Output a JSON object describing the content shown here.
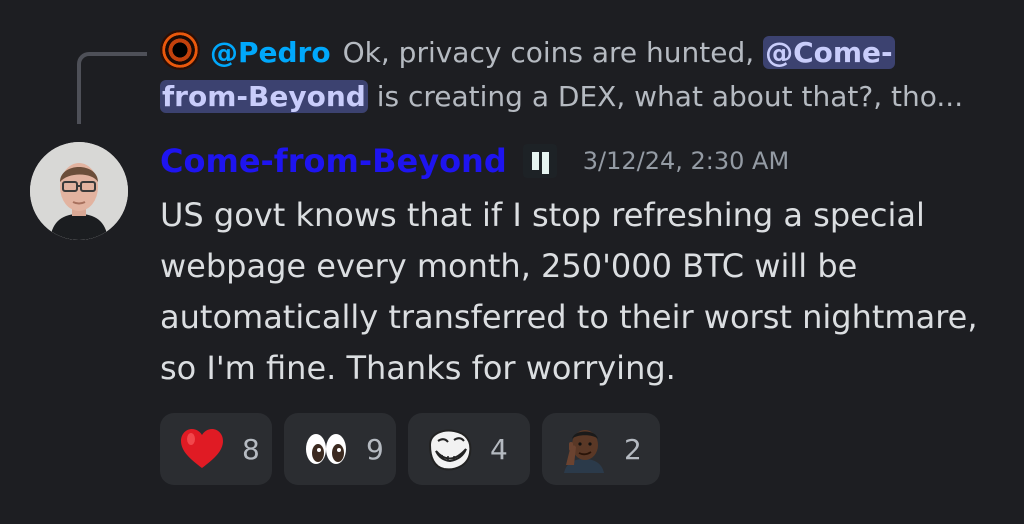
{
  "reply": {
    "author": "@Pedro",
    "text_before": "Ok, privacy coins are hunted,",
    "mention_first_line": "@Come-",
    "mention_second_line": "from-Beyond",
    "text_after": "is creating a DEX, what about that?, tho..."
  },
  "message": {
    "author": "Come-from-Beyond",
    "timestamp": "3/12/24, 2:30 AM",
    "content": "US govt knows that if I stop refreshing a special webpage every month, 250'000 BTC will be automatically transferred to their worst nightmare, so I'm fine. Thanks for worrying."
  },
  "reactions": [
    {
      "emoji": "heart-emoji",
      "count": "8"
    },
    {
      "emoji": "eyes-emoji",
      "count": "9"
    },
    {
      "emoji": "trollface-emoji",
      "count": "4"
    },
    {
      "emoji": "thinking-man-emoji",
      "count": "2"
    }
  ],
  "colors": {
    "background": "#1d1e22",
    "reply_author": "#00a8fc",
    "author": "#1e14f0",
    "mention_bg": "#3c4270",
    "reaction_bg": "#2b2d31"
  }
}
